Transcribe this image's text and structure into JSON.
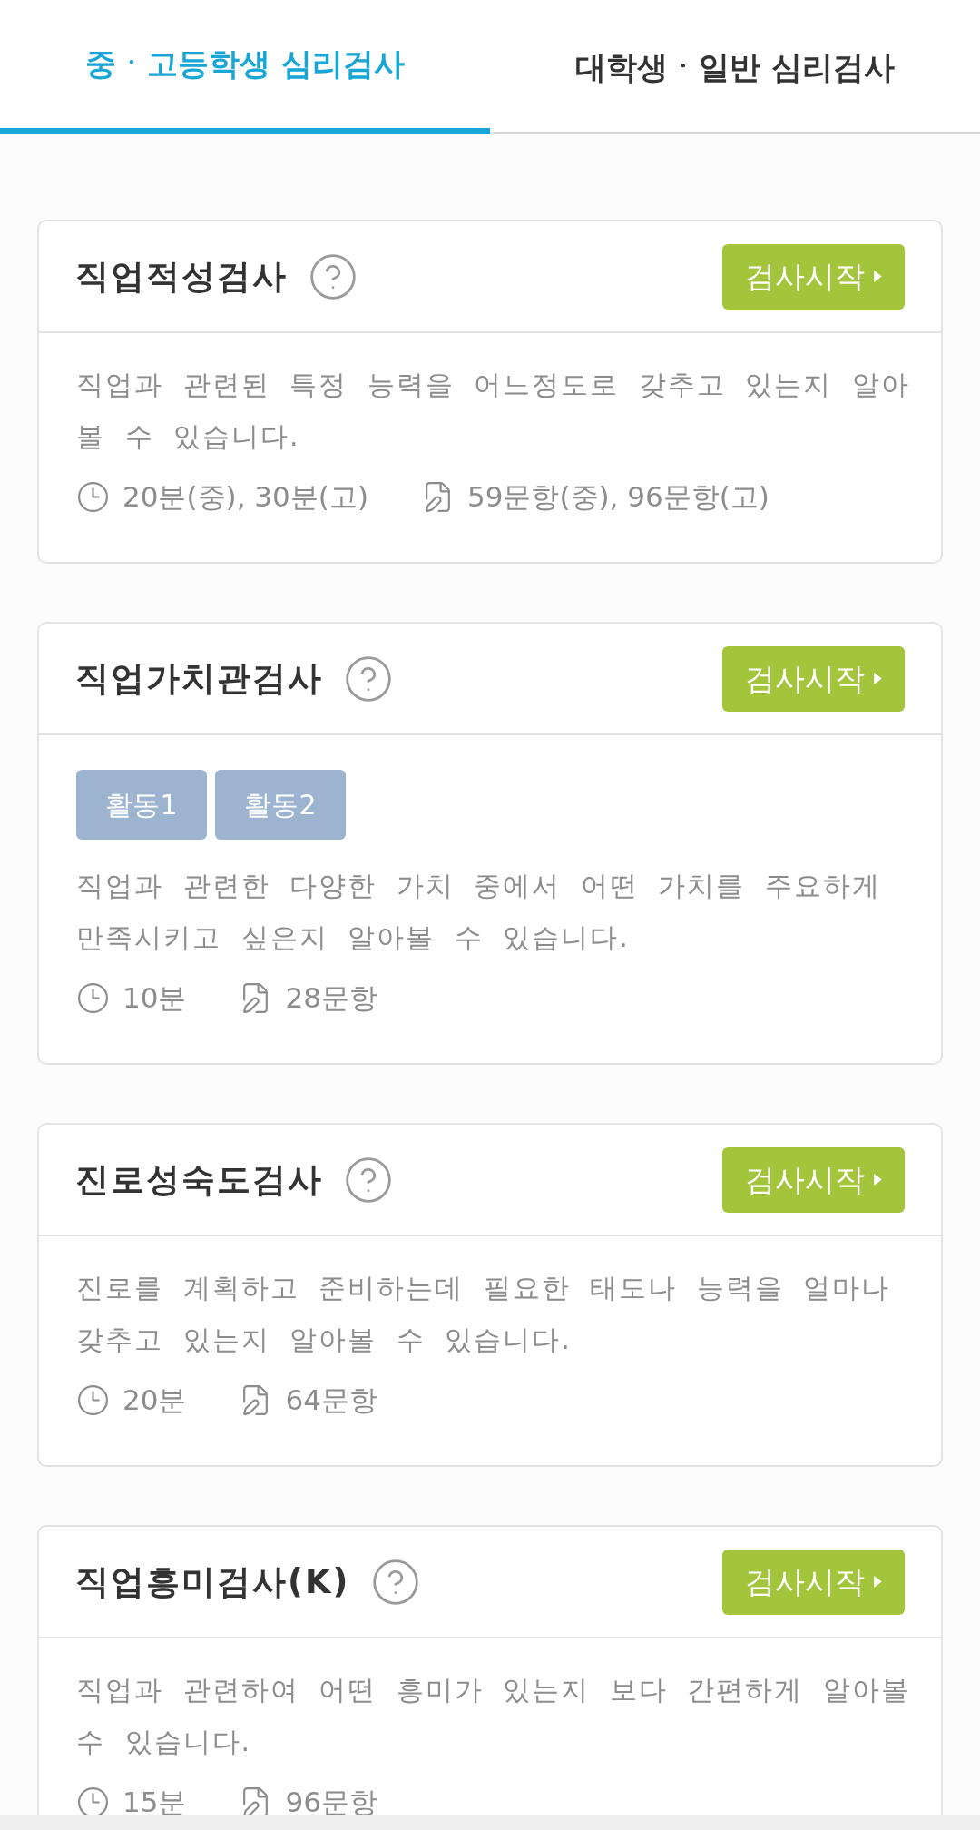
{
  "tabs": [
    {
      "label": "중ㆍ고등학생 심리검사",
      "selected": true
    },
    {
      "label": "대학생ㆍ일반 심리검사",
      "selected": false
    }
  ],
  "tests": [
    {
      "title": "직업적성검사",
      "start_button": "검사시작",
      "description": "직업과 관련된 특정 능력을 어느정도로 갖추고 있는지 알아볼 수 있습니다.",
      "time": "20분(중), 30분(고)",
      "questions": "59문항(중), 96문항(고)"
    },
    {
      "title": "직업가치관검사",
      "start_button": "검사시작",
      "tags": [
        "활동1",
        "활동2"
      ],
      "description": "직업과 관련한 다양한 가치 중에서 어떤 가치를 주요하게 만족시키고 싶은지 알아볼 수 있습니다.",
      "time": "10분",
      "questions": "28문항"
    },
    {
      "title": "진로성숙도검사",
      "start_button": "검사시작",
      "description": "진로를 계획하고 준비하는데 필요한 태도나 능력을 얼마나 갖추고 있는지 알아볼 수 있습니다.",
      "time": "20분",
      "questions": "64문항"
    },
    {
      "title": "직업흥미검사(K)",
      "start_button": "검사시작",
      "description": "직업과 관련하여 어떤 흥미가 있는지 보다 간편하게 알아볼 수 있습니다.",
      "time": "15분",
      "questions": "96문항"
    }
  ]
}
